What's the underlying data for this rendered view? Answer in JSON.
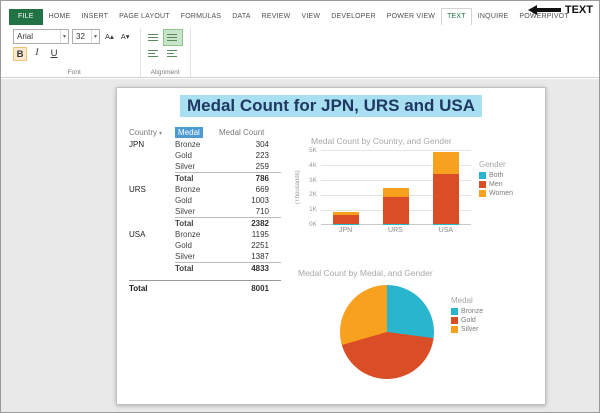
{
  "ribbon": {
    "tabs": [
      {
        "label": "FILE",
        "variant": "file"
      },
      {
        "label": "HOME"
      },
      {
        "label": "INSERT"
      },
      {
        "label": "PAGE LAYOUT"
      },
      {
        "label": "FORMULAS"
      },
      {
        "label": "DATA"
      },
      {
        "label": "REVIEW"
      },
      {
        "label": "VIEW"
      },
      {
        "label": "DEVELOPER"
      },
      {
        "label": "POWER VIEW"
      },
      {
        "label": "TEXT",
        "variant": "active"
      },
      {
        "label": "INQUIRE"
      },
      {
        "label": "POWERPIVOT"
      }
    ],
    "annotation_label": "TEXT",
    "font_group": {
      "label": "Font",
      "font_name": "Arial",
      "font_size": "32",
      "grow_font": "A▴",
      "shrink_font": "A▾",
      "bold": "B",
      "italic": "I",
      "underline": "U",
      "dropdown_icon": "▾"
    },
    "alignment_group": {
      "label": "Alignment"
    }
  },
  "report": {
    "title": "Medal Count for JPN, URS and USA",
    "table": {
      "columns": [
        "Country",
        "Medal",
        "Medal Count"
      ],
      "filter_icon": "▾",
      "total_label": "Total",
      "groups": [
        {
          "country": "JPN",
          "rows": [
            [
              "Bronze",
              304
            ],
            [
              "Gold",
              223
            ],
            [
              "Silver",
              259
            ]
          ],
          "total": 786
        },
        {
          "country": "URS",
          "rows": [
            [
              "Bronze",
              669
            ],
            [
              "Gold",
              1003
            ],
            [
              "Silver",
              710
            ]
          ],
          "total": 2382
        },
        {
          "country": "USA",
          "rows": [
            [
              "Bronze",
              1195
            ],
            [
              "Gold",
              2251
            ],
            [
              "Silver",
              1387
            ]
          ],
          "total": 4833
        }
      ],
      "grand_total": 8001
    }
  },
  "chart_data": [
    {
      "type": "bar",
      "stacked": true,
      "title": "Medal Count by Country, and Gender",
      "categories": [
        "JPN",
        "URS",
        "USA"
      ],
      "series": [
        {
          "name": "Both",
          "color": "#29b5ce",
          "values": [
            16,
            32,
            33
          ]
        },
        {
          "name": "Men",
          "color": "#d94e27",
          "values": [
            560,
            1800,
            3300
          ]
        },
        {
          "name": "Women",
          "color": "#f7a11e",
          "values": [
            210,
            550,
            1500
          ]
        }
      ],
      "ylabel": "(Thousands)",
      "ylim": [
        0,
        5000
      ],
      "yticks": [
        "0K",
        "1K",
        "2K",
        "3K",
        "4K",
        "5K"
      ],
      "legend_title": "Gender",
      "legend_position": "right"
    },
    {
      "type": "pie",
      "title": "Medal Count by Medal, and Gender",
      "slices": [
        {
          "label": "Bronze",
          "value": 2168,
          "color": "#29b5ce"
        },
        {
          "label": "Gold",
          "value": 3477,
          "color": "#d94e27"
        },
        {
          "label": "Silver",
          "value": 2356,
          "color": "#f7a11e"
        }
      ],
      "legend_title": "Medal",
      "legend_position": "right"
    }
  ],
  "colors": {
    "excel_green": "#217346",
    "title_highlight": "#a9e0f1",
    "title_text": "#1f3864",
    "header_blue": "#4e9bd4"
  }
}
